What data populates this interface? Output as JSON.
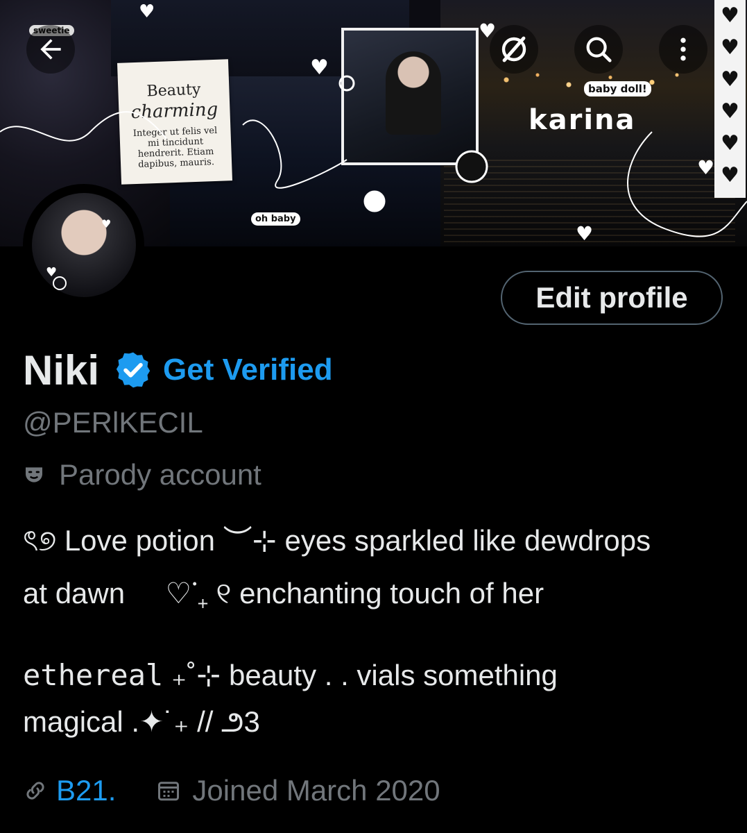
{
  "banner": {
    "sticker_sweetie": "sweetie",
    "note_title": "Beauty",
    "note_subtitle": "charming",
    "note_body": "Integer ut felis vel mi tincidunt hendrerit. Etiam dapibus, mauris.",
    "sticker_babydoll": "baby doll!",
    "title_karina": "karina",
    "sticker_ohbaby": "oh baby"
  },
  "topbar": {
    "back_icon": "arrow-left-icon",
    "grok_icon": "slash-circle-icon",
    "search_icon": "search-icon",
    "more_icon": "more-vertical-icon"
  },
  "profile": {
    "edit_label": "Edit profile",
    "display_name": "Niki",
    "get_verified": "Get Verified",
    "handle": "@PERlKECIL",
    "parody_label": "Parody account",
    "bio_line1": "ৎ୭ Love potion ︶⊹ eyes sparkled like dewdrops",
    "bio_line2": "at dawn     ♡ᣟ₊ ୧ enchanting touch of her",
    "bio_line3_mono": "ethereal",
    "bio_line3_rest": " ₊˚⊹ beauty . . vials something",
    "bio_line4": "magical .✦˙₊ // ౨3",
    "link": "B21.",
    "joined": "Joined March 2020"
  },
  "colors": {
    "accent": "#1d9bf0",
    "text_primary": "#e7e9ea",
    "text_secondary": "#71767b",
    "border": "#536471",
    "background": "#000000"
  }
}
